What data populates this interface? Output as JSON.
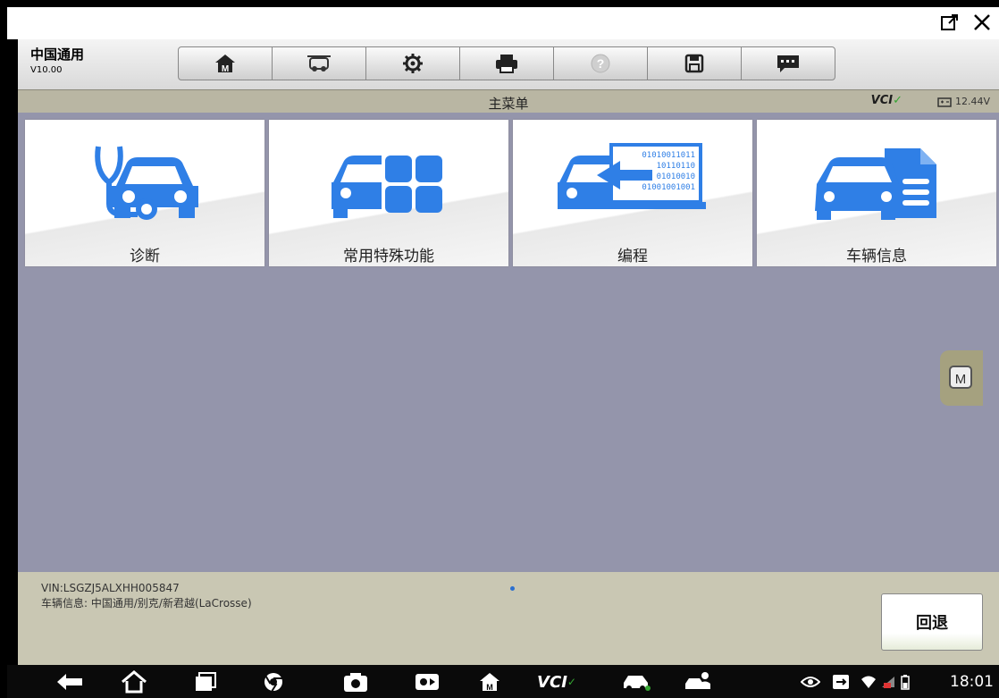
{
  "app": {
    "name": "中国通用",
    "version": "V10.00"
  },
  "toolbar": {
    "buttons": [
      "home-icon",
      "diagnose-icon",
      "settings-icon",
      "print-icon",
      "help-icon",
      "save-icon",
      "message-icon"
    ]
  },
  "menubar": {
    "title": "主菜单",
    "vci": "VCI",
    "battery": "12.44V"
  },
  "tiles": [
    {
      "label": "诊断",
      "icon": "diagnosis-icon"
    },
    {
      "label": "常用特殊功能",
      "icon": "special-functions-icon"
    },
    {
      "label": "编程",
      "icon": "programming-icon"
    },
    {
      "label": "车辆信息",
      "icon": "vehicle-info-icon"
    }
  ],
  "programming_bits": [
    "01010011011",
    "10110110",
    "01010010",
    "01001001001"
  ],
  "side_button": "M",
  "footer": {
    "vin": "VIN:LSGZJ5ALXHH005847",
    "vehicle_info": "车辆信息: 中国通用/别克/新君越(LaCrosse)",
    "back_label": "回退"
  },
  "navbar": {
    "vci": "VCI",
    "clock": "18:01"
  },
  "colors": {
    "accent": "#2f7fe6",
    "menubar": "#b9b6a3",
    "content": "#9495ab",
    "footer": "#c9c7b3"
  }
}
